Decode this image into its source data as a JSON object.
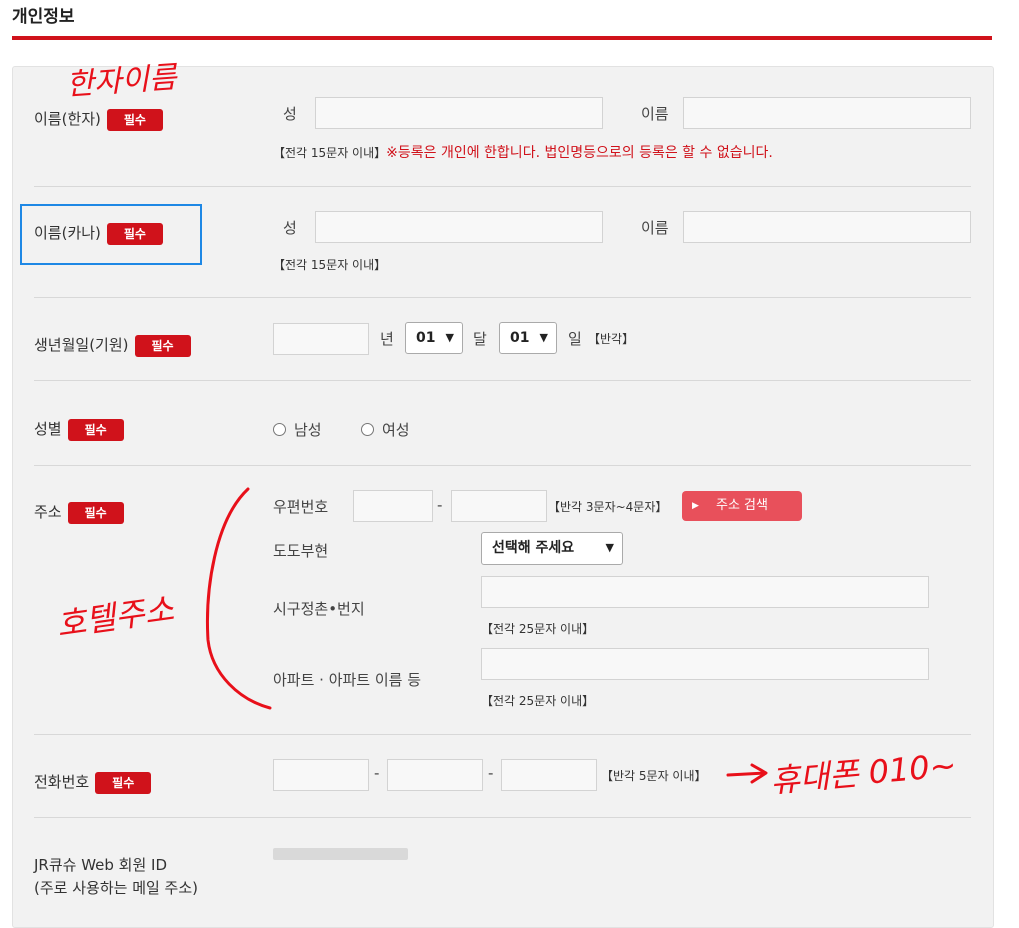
{
  "section_title": "개인정보",
  "required_badge": "필수",
  "name_kanji": {
    "label": "이름(한자)",
    "last_label": "성",
    "first_label": "이름",
    "note": "【전각 15문자 이내】",
    "warning": "※등록은 개인에 한합니다. 법인명등으로의 등록은 할 수 없습니다.",
    "annotation": "한자이름"
  },
  "name_kana": {
    "label": "이름(카나)",
    "last_label": "성",
    "first_label": "이름",
    "note": "【전각 15문자 이내】"
  },
  "birthday": {
    "label": "생년월일(기원)",
    "year_unit": "년",
    "month_value": "01",
    "month_unit": "달",
    "day_value": "01",
    "day_unit": "일",
    "note": "【반각】"
  },
  "gender": {
    "label": "성별",
    "options": [
      "남성",
      "여성"
    ]
  },
  "address": {
    "label": "주소",
    "postal_label": "우편번호",
    "postal_dash": "-",
    "postal_note": "【반각 3문자~4문자】",
    "search_button": "주소 검색",
    "prefecture_label": "도도부현",
    "prefecture_value": "선택해 주세요",
    "city_label": "시구정촌•번지",
    "city_note": "【전각 25문자 이내】",
    "building_label": "아파트 · 아파트 이름 등",
    "building_note": "【전각 25문자 이내】",
    "annotation": "호텔주소"
  },
  "phone": {
    "label": "전화번호",
    "dash": "-",
    "note": "【반각 5문자 이내】",
    "annotation": "휴대폰 010~"
  },
  "member_id": {
    "label_line1": "JR큐슈 Web 회원 ID",
    "label_line2": "(주로 사용하는 메일 주소)"
  },
  "colors": {
    "accent": "#d0121b",
    "button": "#e8505b",
    "highlight": "#1e88e5",
    "panel": "#f2f2f2"
  }
}
